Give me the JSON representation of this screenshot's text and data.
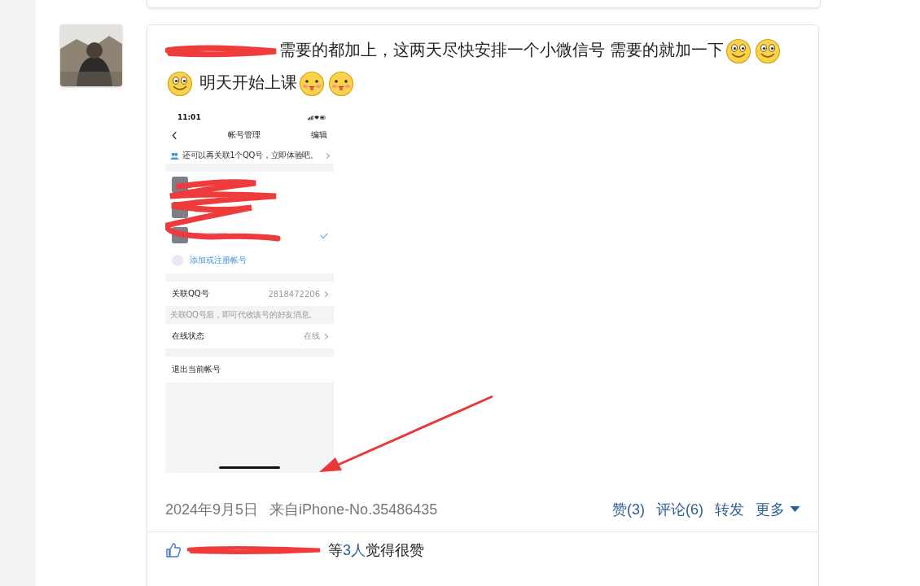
{
  "post": {
    "content": [
      {
        "kind": "redaction"
      },
      {
        "kind": "text",
        "text": "需要的都加上，这两天尽快安排一个小微信号 需要的就加一下"
      },
      {
        "kind": "smile"
      },
      {
        "kind": "smile"
      },
      {
        "kind": "smile"
      },
      {
        "kind": "text",
        "text": " 明天开始上课"
      },
      {
        "kind": "pig"
      },
      {
        "kind": "pig"
      }
    ],
    "screenshot": {
      "time": "11:01",
      "title": "帐号管理",
      "edit": "编辑",
      "banner": "还可以再关联1个QQ号，立即体验吧。",
      "add_account": "添加或注册帐号",
      "rows": [
        {
          "kind": "row",
          "label": "关联QQ号",
          "value": "2818472206"
        },
        {
          "kind": "note",
          "label": "关联QQ号后，即可代收该号的好友消息。"
        },
        {
          "kind": "row",
          "label": "在线状态",
          "value": "在线"
        },
        {
          "kind": "gap"
        },
        {
          "kind": "plain",
          "label": "退出当前帐号"
        }
      ]
    },
    "date": "2024年9月5日",
    "source": "来自iPhone-No.35486435",
    "actions": [
      {
        "kind": "link",
        "label": "赞(3)"
      },
      {
        "kind": "link",
        "label": "评论(6)"
      },
      {
        "kind": "link",
        "label": "转发"
      },
      {
        "kind": "menu",
        "label": "更多"
      }
    ],
    "likes": {
      "prefix": "等",
      "count": "3人",
      "suffix": "觉得很赞"
    }
  }
}
